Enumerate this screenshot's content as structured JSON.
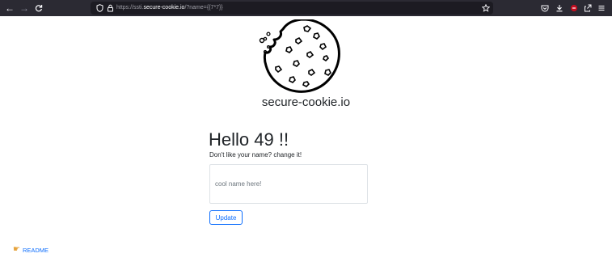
{
  "browser": {
    "url_prefix": "https://ssti.",
    "url_host": "secure-cookie.io",
    "url_path": "/?name={{7*7}}",
    "icons": {
      "back": "back-arrow-icon",
      "forward": "forward-arrow-icon",
      "reload": "reload-icon",
      "shield": "shield-icon",
      "lock": "lock-icon",
      "bookmark": "star-icon",
      "pocket": "pocket-icon",
      "downloads": "download-icon",
      "extension": "extension-icon",
      "share": "share-icon",
      "menu": "hamburger-menu-icon"
    }
  },
  "site": {
    "title": "secure-cookie.io",
    "logo_icon": "cookie-icon"
  },
  "main": {
    "greeting": "Hello 49 !!",
    "prompt": "Don't like your name? change it!",
    "name_input": {
      "value": "",
      "placeholder": "cool name here!"
    },
    "update_label": "Update"
  },
  "footer": {
    "readme_label": "README",
    "readme_icon": "pointing-hand-icon"
  },
  "colors": {
    "toolbar_bg": "#2b2a33",
    "urlbar_bg": "#1c1b22",
    "link": "#0d6efd",
    "text": "#212529"
  }
}
